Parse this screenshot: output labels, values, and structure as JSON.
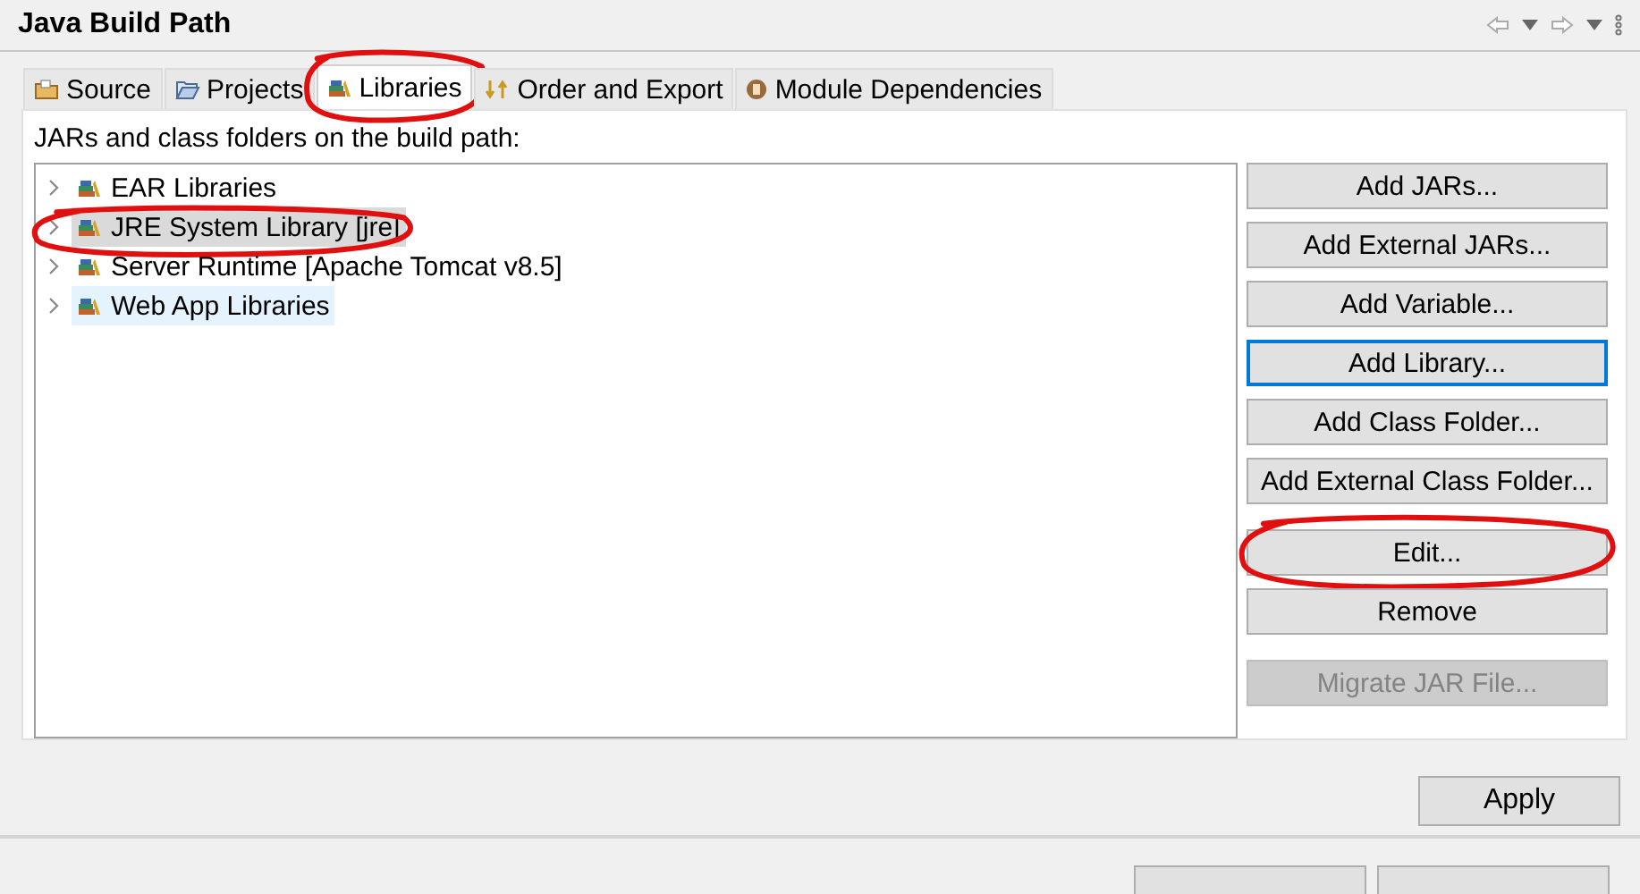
{
  "window": {
    "title": "Java Build Path"
  },
  "tabs": [
    {
      "label": "Source",
      "selected": false,
      "annotated": false
    },
    {
      "label": "Projects",
      "selected": false,
      "annotated": false
    },
    {
      "label": "Libraries",
      "selected": true,
      "annotated": true
    },
    {
      "label": "Order and Export",
      "selected": false,
      "annotated": false
    },
    {
      "label": "Module Dependencies",
      "selected": false,
      "annotated": false
    }
  ],
  "panel": {
    "label": "JARs and class folders on the build path:",
    "tree": [
      {
        "label": "EAR Libraries",
        "expanded": false,
        "selected": false,
        "hovered": false,
        "annotated": false
      },
      {
        "label": "JRE System Library [jre]",
        "expanded": false,
        "selected": true,
        "hovered": false,
        "annotated": true
      },
      {
        "label": "Server Runtime [Apache Tomcat v8.5]",
        "expanded": false,
        "selected": false,
        "hovered": false,
        "annotated": false
      },
      {
        "label": "Web App Libraries",
        "expanded": false,
        "selected": false,
        "hovered": true,
        "annotated": false
      }
    ],
    "button_groups": [
      [
        {
          "label": "Add JARs...",
          "focused": false,
          "disabled": false,
          "annotated": false
        },
        {
          "label": "Add External JARs...",
          "focused": false,
          "disabled": false,
          "annotated": false
        },
        {
          "label": "Add Variable...",
          "focused": false,
          "disabled": false,
          "annotated": false
        },
        {
          "label": "Add Library...",
          "focused": true,
          "disabled": false,
          "annotated": false
        },
        {
          "label": "Add Class Folder...",
          "focused": false,
          "disabled": false,
          "annotated": false
        },
        {
          "label": "Add External Class Folder...",
          "focused": false,
          "disabled": false,
          "annotated": false
        }
      ],
      [
        {
          "label": "Edit...",
          "focused": false,
          "disabled": false,
          "annotated": true
        },
        {
          "label": "Remove",
          "focused": false,
          "disabled": false,
          "annotated": false
        }
      ],
      [
        {
          "label": "Migrate JAR File...",
          "focused": false,
          "disabled": true,
          "annotated": false
        }
      ]
    ]
  },
  "apply": {
    "label": "Apply"
  },
  "dialog_buttons": [
    {
      "disabled": false
    },
    {
      "disabled": false
    }
  ]
}
